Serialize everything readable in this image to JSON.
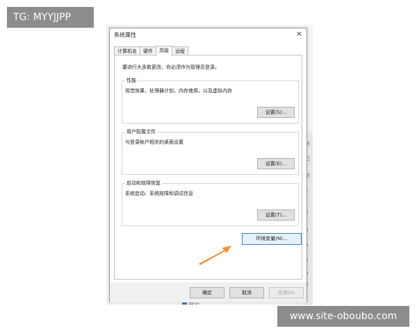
{
  "watermarks": {
    "top_left": "TG: MYYJJPP",
    "bottom_right": "www.site-oboubo.com"
  },
  "background": {
    "taskbar_text": "音乐",
    "strip_chars": [
      "自",
      "己",
      "你",
      "2",
      "3",
      "0",
      "0",
      "0",
      "0",
      "0",
      "1"
    ]
  },
  "dialog": {
    "title": "系统属性",
    "close_symbol": "×",
    "tabs": [
      {
        "label": "计算机名",
        "active": false
      },
      {
        "label": "硬件",
        "active": false
      },
      {
        "label": "高级",
        "active": true
      },
      {
        "label": "远程",
        "active": false
      }
    ],
    "notice": "要进行大多数更改，你必须作为管理员登录。",
    "groups": {
      "performance": {
        "title": "性能",
        "description": "视觉效果，处理器计划，内存使用，以及虚拟内存",
        "button": "设置(S)..."
      },
      "user_profiles": {
        "title": "用户配置文件",
        "description": "与登录帐户相关的桌面设置",
        "button": "设置(E)..."
      },
      "startup_recovery": {
        "title": "启动和故障恢复",
        "description": "系统启动、系统故障和调试信息",
        "button": "设置(T)..."
      }
    },
    "env_button": "环境变量(N)...",
    "footer": {
      "ok": "确定",
      "cancel": "取消",
      "apply": "应用(A)"
    },
    "accent_arrow_color": "#f0913a"
  }
}
